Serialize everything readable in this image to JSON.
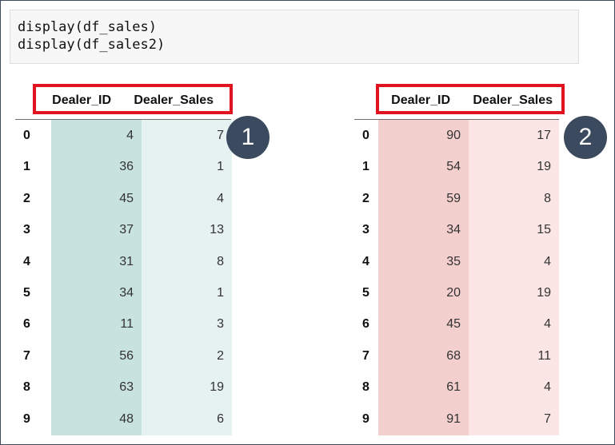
{
  "code": {
    "lines": [
      "display(df_sales)",
      "display(df_sales2)"
    ]
  },
  "colors": {
    "teal_id": "#c8e2df",
    "teal_sales": "#e6f2f1",
    "red_id": "#f3d0ce",
    "red_sales": "#fbe6e5",
    "highlight_border": "#e0131e",
    "badge": "#3b4a5e"
  },
  "tables": [
    {
      "badge": "1",
      "columns": [
        "Dealer_ID",
        "Dealer_Sales"
      ],
      "rows": [
        {
          "index": "0",
          "Dealer_ID": "4",
          "Dealer_Sales": "7"
        },
        {
          "index": "1",
          "Dealer_ID": "36",
          "Dealer_Sales": "1"
        },
        {
          "index": "2",
          "Dealer_ID": "45",
          "Dealer_Sales": "4"
        },
        {
          "index": "3",
          "Dealer_ID": "37",
          "Dealer_Sales": "13"
        },
        {
          "index": "4",
          "Dealer_ID": "31",
          "Dealer_Sales": "8"
        },
        {
          "index": "5",
          "Dealer_ID": "34",
          "Dealer_Sales": "1"
        },
        {
          "index": "6",
          "Dealer_ID": "11",
          "Dealer_Sales": "3"
        },
        {
          "index": "7",
          "Dealer_ID": "56",
          "Dealer_Sales": "2"
        },
        {
          "index": "8",
          "Dealer_ID": "63",
          "Dealer_Sales": "19"
        },
        {
          "index": "9",
          "Dealer_ID": "48",
          "Dealer_Sales": "6"
        }
      ]
    },
    {
      "badge": "2",
      "columns": [
        "Dealer_ID",
        "Dealer_Sales"
      ],
      "rows": [
        {
          "index": "0",
          "Dealer_ID": "90",
          "Dealer_Sales": "17"
        },
        {
          "index": "1",
          "Dealer_ID": "54",
          "Dealer_Sales": "19"
        },
        {
          "index": "2",
          "Dealer_ID": "59",
          "Dealer_Sales": "8"
        },
        {
          "index": "3",
          "Dealer_ID": "34",
          "Dealer_Sales": "15"
        },
        {
          "index": "4",
          "Dealer_ID": "35",
          "Dealer_Sales": "4"
        },
        {
          "index": "5",
          "Dealer_ID": "20",
          "Dealer_Sales": "19"
        },
        {
          "index": "6",
          "Dealer_ID": "45",
          "Dealer_Sales": "4"
        },
        {
          "index": "7",
          "Dealer_ID": "68",
          "Dealer_Sales": "11"
        },
        {
          "index": "8",
          "Dealer_ID": "61",
          "Dealer_Sales": "4"
        },
        {
          "index": "9",
          "Dealer_ID": "91",
          "Dealer_Sales": "7"
        }
      ]
    }
  ]
}
